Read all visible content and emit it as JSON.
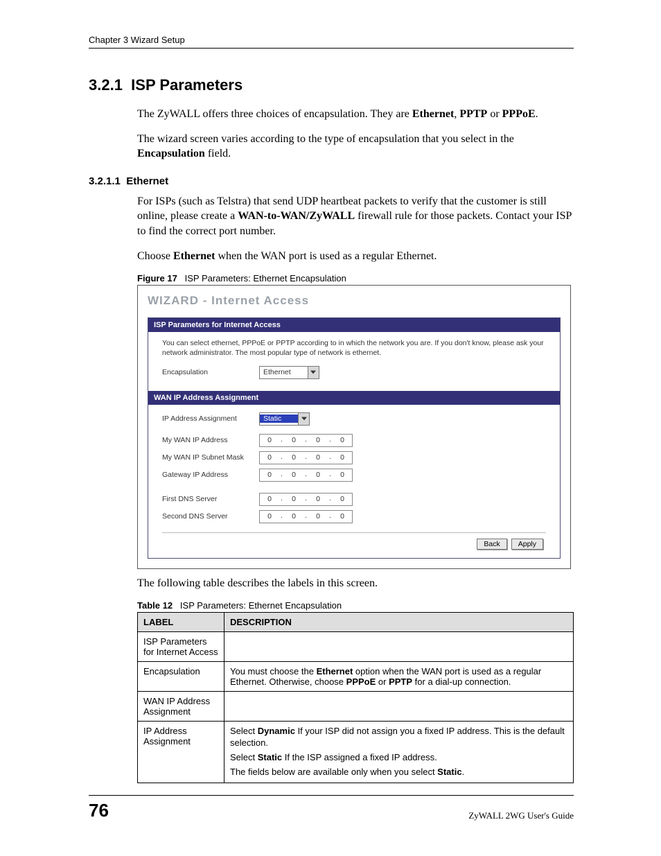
{
  "header": {
    "chapter": "Chapter 3 Wizard Setup"
  },
  "section": {
    "number": "3.2.1",
    "title": "ISP Parameters"
  },
  "subsection": {
    "number": "3.2.1.1",
    "title": "Ethernet"
  },
  "figure": {
    "label": "Figure 17",
    "title": "ISP Parameters: Ethernet Encapsulation"
  },
  "wizard": {
    "title": "WIZARD - Internet Access",
    "sections": [
      {
        "title": "ISP Parameters for Internet Access",
        "desc": "You can select ethernet, PPPoE or PPTP according to in which the network you are. If you don't know, please ask your network administrator. The most popular type of network is ethernet.",
        "fields": [
          {
            "label": "Encapsulation",
            "value": "Ethernet"
          }
        ]
      },
      {
        "title": "WAN IP Address Assignment",
        "fields": [
          {
            "label": "IP Address Assignment",
            "value": "Static"
          },
          {
            "label": "My WAN IP Address"
          },
          {
            "label": "My WAN IP Subnet Mask"
          },
          {
            "label": "Gateway IP Address"
          },
          {
            "label": "First DNS Server"
          },
          {
            "label": "Second DNS Server"
          }
        ]
      }
    ],
    "ip": [
      "0",
      "0",
      "0",
      "0"
    ],
    "buttons": [
      "Back",
      "Apply"
    ]
  },
  "table_intro": "The following table describes the labels in this screen.",
  "table": {
    "label": "Table 12",
    "title": "ISP Parameters: Ethernet Encapsulation",
    "headers": [
      "LABEL",
      "DESCRIPTION"
    ],
    "rows": [
      {
        "label": "ISP Parameters for Internet Access",
        "desc": ""
      },
      {
        "label": "Encapsulation",
        "desc": "You must choose the Ethernet option when the WAN port is used as a regular Ethernet. Otherwise, choose PPPoE or PPTP for a dial-up connection."
      },
      {
        "label": "WAN IP Address Assignment",
        "desc": ""
      },
      {
        "label": "IP Address Assignment",
        "desc": "Select Dynamic If your ISP did not assign you a fixed IP address. This is the default selection. Select Static If the ISP assigned a fixed IP address. The fields below are available only when you select Static."
      }
    ]
  },
  "footer": {
    "page": "76",
    "guide": "ZyWALL 2WG User's Guide"
  }
}
